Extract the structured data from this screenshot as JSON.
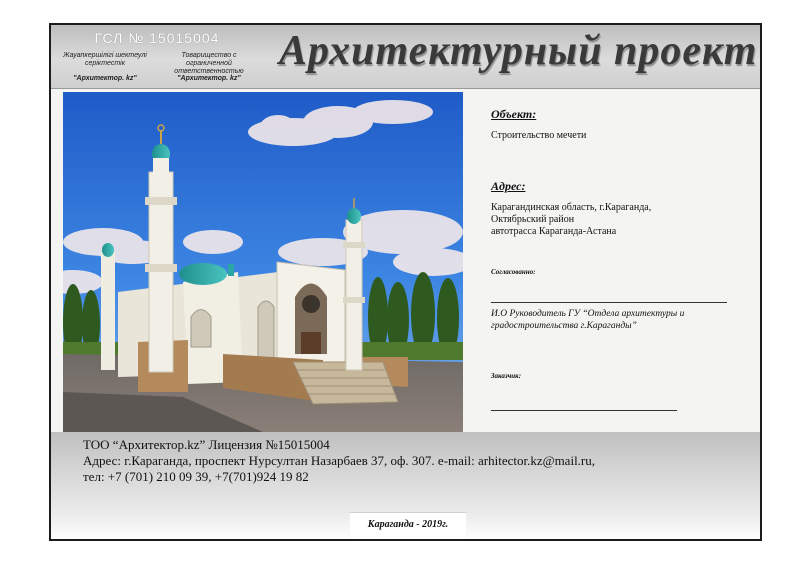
{
  "header": {
    "license_number": "ГСЛ № 15015004",
    "left_col_text": "Жауапкершілігі шектеулі серіктестік",
    "left_col_brand": "\"Архитектор. kz\"",
    "right_col_text": "Товарищество с ограниченной ответственностью",
    "right_col_brand": "\"Архитектор. kz\"",
    "title": "Архитектурный проект"
  },
  "object": {
    "label": "Объект:",
    "value": "Строительство мечети"
  },
  "address": {
    "label": "Адрес:",
    "lines": [
      "Карагандинская область, г.Караганда,",
      "Октябрьский район",
      "автотрасса Караганда-Астана"
    ]
  },
  "approval": {
    "label": "Согласованно:",
    "signatory_lines": [
      "И.О Руководитель ГУ “Отдела архитектуры и",
      "градостроительства г.Караганды”"
    ]
  },
  "customer": {
    "label": "Заказчик:"
  },
  "footer": {
    "company_line": "ТОО “Архитектор.kz” Лицензия №15015004",
    "address_line": "Адрес: г.Караганда, проспект Нурсултан Назарбаев 37, оф. 307. e-mail: arhitector.kz@mail.ru,",
    "phone_line": "тел: +7 (701) 210 09 39, +7(701)924 19 82",
    "city_year": "Караганда - 2019г."
  },
  "colors": {
    "sky": "#2f6fd8",
    "dome": "#2aa7a4",
    "wall": "#efece2",
    "stone": "#b48a5c"
  }
}
